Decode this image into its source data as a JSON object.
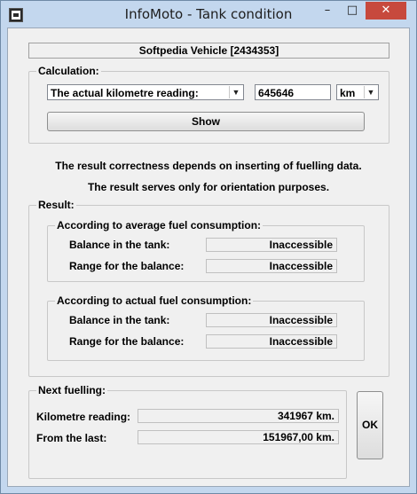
{
  "window": {
    "title": "InfoMoto - Tank condition",
    "controls": {
      "minimize": "–",
      "maximize": "□",
      "close": "✕"
    },
    "icon": "app-icon"
  },
  "vehicle": "Softpedia Vehicle [2434353]",
  "calculation": {
    "legend": "Calculation:",
    "mode_select": "The actual kilometre reading:",
    "reading_value": "645646",
    "unit_select": "km",
    "show_button": "Show"
  },
  "notes": [
    "The result correctness depends on inserting of fuelling data.",
    "The result serves only for orientation purposes."
  ],
  "result": {
    "legend": "Result:",
    "average": {
      "legend": "According to average fuel consumption:",
      "balance_label": "Balance in the tank:",
      "balance_value": "Inaccessible",
      "range_label": "Range for the balance:",
      "range_value": "Inaccessible"
    },
    "actual": {
      "legend": "According to actual fuel consumption:",
      "balance_label": "Balance in the tank:",
      "balance_value": "Inaccessible",
      "range_label": "Range for the balance:",
      "range_value": "Inaccessible"
    }
  },
  "next_fuelling": {
    "legend": "Next fuelling:",
    "km_label": "Kilometre reading:",
    "km_value": "341967 km.",
    "last_label": "From the last:",
    "last_value": "151967,00 km."
  },
  "ok_button": "OK"
}
